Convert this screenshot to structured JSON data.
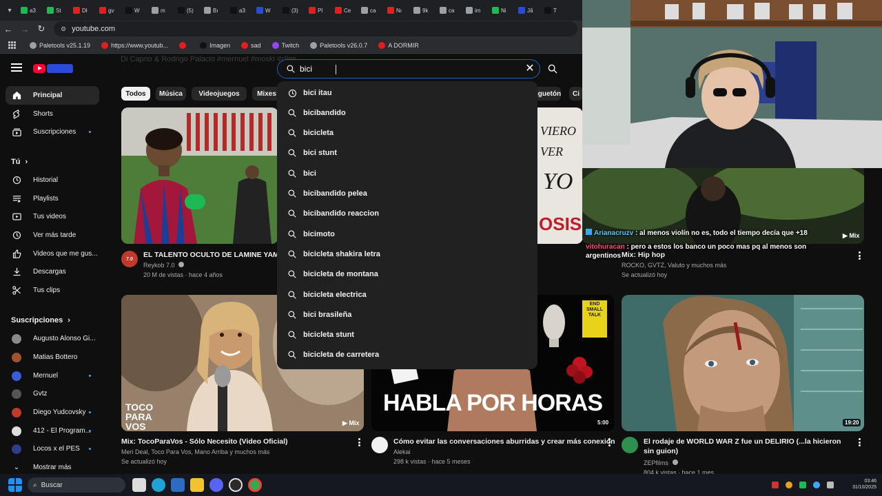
{
  "browser": {
    "tabs": [
      "a3",
      "St",
      "Dł",
      "gv",
      "W",
      "m",
      "(5)",
      "Bı",
      "a3",
      "W",
      "(3)",
      "Pl",
      "Ce",
      "ca",
      "Nı",
      "9k",
      "ca",
      "im",
      "Ni",
      "Jấ",
      "T"
    ],
    "tab_colors": [
      "#1db954",
      "#1db954",
      "#e02020",
      "#e02020",
      "#111111",
      "#9aa0a6",
      "#111111",
      "#9aa0a6",
      "#111111",
      "#2a4ad8",
      "#111111",
      "#e02020",
      "#e02020",
      "#9aa0a6",
      "#e02020",
      "#9aa0a6",
      "#9aa0a6",
      "#9aa0a6",
      "#1db954",
      "#2a4ad8",
      "#111111"
    ],
    "url": "youtube.com",
    "bookmarks": [
      {
        "label": "Paletools v25.1.19",
        "color": "#9aa0a6"
      },
      {
        "label": "https://www.youtub...",
        "color": "#e02020"
      },
      {
        "label": "",
        "color": "#e02020"
      },
      {
        "label": "Imagen",
        "color": "#111111"
      },
      {
        "label": "sad",
        "color": "#e02020"
      },
      {
        "label": "Twitch",
        "color": "#9146ff"
      },
      {
        "label": "Paletools v26.0.7",
        "color": "#9aa0a6"
      },
      {
        "label": "A DORMIR",
        "color": "#e02020"
      }
    ]
  },
  "header": {
    "ghost_text": "Di Caprio & Rodrigo Palacio #mernuel #moski #clips",
    "search_value": "bici"
  },
  "sidebar": {
    "main": [
      {
        "label": "Principal",
        "icon": "home-icon",
        "active": true
      },
      {
        "label": "Shorts",
        "icon": "shorts-icon"
      },
      {
        "label": "Suscripciones",
        "icon": "subscriptions-icon",
        "dot": true
      }
    ],
    "you_title": "Tú",
    "you": [
      {
        "label": "Historial",
        "icon": "history-icon"
      },
      {
        "label": "Playlists",
        "icon": "playlists-icon"
      },
      {
        "label": "Tus videos",
        "icon": "your-videos-icon"
      },
      {
        "label": "Ver más tarde",
        "icon": "watch-later-icon"
      },
      {
        "label": "Videos que me gus...",
        "icon": "liked-videos-icon"
      },
      {
        "label": "Descargas",
        "icon": "downloads-icon"
      },
      {
        "label": "Tus clips",
        "icon": "clips-icon"
      }
    ],
    "subs_title": "Suscripciones",
    "subs": [
      {
        "label": "Augusto Alonso Gi...",
        "color": "#8a8a8a"
      },
      {
        "label": "Matias Bottero",
        "color": "#a0522d"
      },
      {
        "label": "Mernuel",
        "color": "#3b5bdb",
        "dot": true
      },
      {
        "label": "Gvtz",
        "color": "#555555"
      },
      {
        "label": "Diego Yudcovsky",
        "color": "#c0392b",
        "dot": true
      },
      {
        "label": "412 - El Program...",
        "color": "#dddddd",
        "dot": true
      },
      {
        "label": "Locos x el PES",
        "color": "#2c3e8c",
        "dot": true
      }
    ],
    "show_more": "Mostrar más"
  },
  "chips": [
    "Todos",
    "Música",
    "Videojuegos",
    "Mixes",
    "Reguetón",
    "Ci"
  ],
  "suggestions": [
    {
      "text": "bici itau",
      "icon": "history-icon"
    },
    {
      "text": "bicibandido",
      "icon": "search-icon"
    },
    {
      "text": "bicicleta",
      "icon": "search-icon"
    },
    {
      "text": "bici stunt",
      "icon": "search-icon"
    },
    {
      "text": "bici",
      "icon": "search-icon"
    },
    {
      "text": "bicibandido pelea",
      "icon": "search-icon"
    },
    {
      "text": "bicibandido reaccion",
      "icon": "search-icon"
    },
    {
      "text": "bicimoto",
      "icon": "search-icon"
    },
    {
      "text": "bicicleta shakira letra",
      "icon": "search-icon"
    },
    {
      "text": "bicicleta de montana",
      "icon": "search-icon"
    },
    {
      "text": "bicicleta electrica",
      "icon": "search-icon"
    },
    {
      "text": "bici brasileña",
      "icon": "search-icon"
    },
    {
      "text": "bicicleta stunt",
      "icon": "search-icon"
    },
    {
      "text": "bicicleta de carretera",
      "icon": "search-icon"
    }
  ],
  "videos": {
    "v1": {
      "title": "EL TALENTO OCULTO DE LAMINE YAMAL",
      "channel": "Reykob 7.0",
      "meta": "20 M de vistas · hace 4 años",
      "avatar_text": "7.0"
    },
    "v2": {
      "title": "Mix: Hip hop",
      "channel": "ROCKO, GVTZ, Valuto y muchos más",
      "meta": "Se actualizó hoy",
      "badge": "Mix",
      "thumb_text": "VIERO VER YO OSIS"
    },
    "v3": {
      "title": "Mix: TocoParaVos - Sólo Necesito (Video Oficial)",
      "channel": "Meri Deal, Toco Para Vos, Mano Arriba y muchos más",
      "meta": "Se actualizó hoy",
      "badge": "Mix",
      "thumb_text": "TOCO PARA VOS"
    },
    "v4": {
      "title": "Cómo evitar las conversaciones aburridas y crear más conexión",
      "channel": "Alekai",
      "meta": "298 k vistas · hace 5 meses",
      "duration": "5:00",
      "thumb_text": "HABLA POR HORAS",
      "book_text": "END SMALL TALK"
    },
    "v5": {
      "title": "El rodaje de WORLD WAR Z fue un DELIRIO (...la hicieron sin guion)",
      "channel": "ZEPfilms",
      "meta": "804 k vistas · hace 1 mes",
      "duration": "19:20"
    }
  },
  "chat": [
    {
      "user": "Arianacruzv",
      "text": " : al menos violín no es, todo el tiempo decía que +18"
    },
    {
      "user": "vitohuracan",
      "text": " : pero a estos los banco un poco mas pq al menos son argentinos"
    }
  ],
  "taskbar": {
    "search_placeholder": "Buscar",
    "time": "03:46",
    "date": "31/10/2025"
  },
  "colors": {
    "accent": "#3ea6ff",
    "youtube_red": "#ff0033",
    "search_border": "#1c62b9"
  }
}
